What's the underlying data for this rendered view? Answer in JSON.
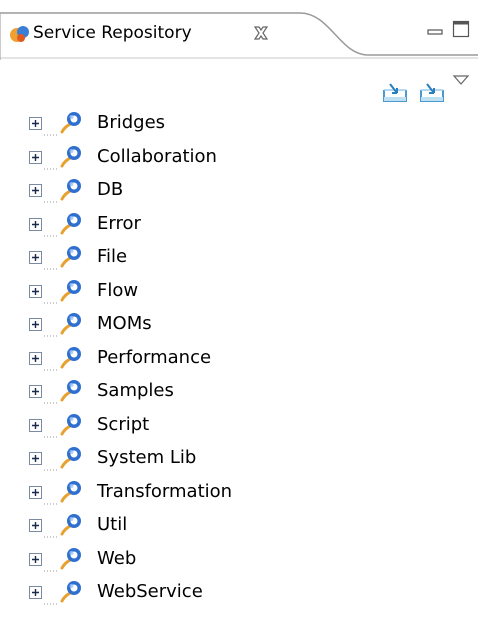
{
  "view": {
    "title": "Service Repository",
    "close_icon": "close-x-icon",
    "minimize_icon": "minimize-icon",
    "maximize_icon": "maximize-icon"
  },
  "toolbar": {
    "buttons": [
      "import-icon",
      "export-icon"
    ],
    "view_menu_icon": "chevron-down-icon"
  },
  "tree": {
    "items": [
      {
        "label": "Bridges"
      },
      {
        "label": "Collaboration"
      },
      {
        "label": "DB"
      },
      {
        "label": "Error"
      },
      {
        "label": "File"
      },
      {
        "label": "Flow"
      },
      {
        "label": "MOMs"
      },
      {
        "label": "Performance"
      },
      {
        "label": "Samples"
      },
      {
        "label": "Script"
      },
      {
        "label": "System Lib"
      },
      {
        "label": "Transformation"
      },
      {
        "label": "Util"
      },
      {
        "label": "Web"
      },
      {
        "label": "WebService"
      }
    ]
  },
  "colors": {
    "tab_border": "#9a9a9a",
    "toolbar_icon": "#2a7fbf",
    "node_icon_blue": "#2f6fd0",
    "node_icon_orange": "#e8a030"
  }
}
